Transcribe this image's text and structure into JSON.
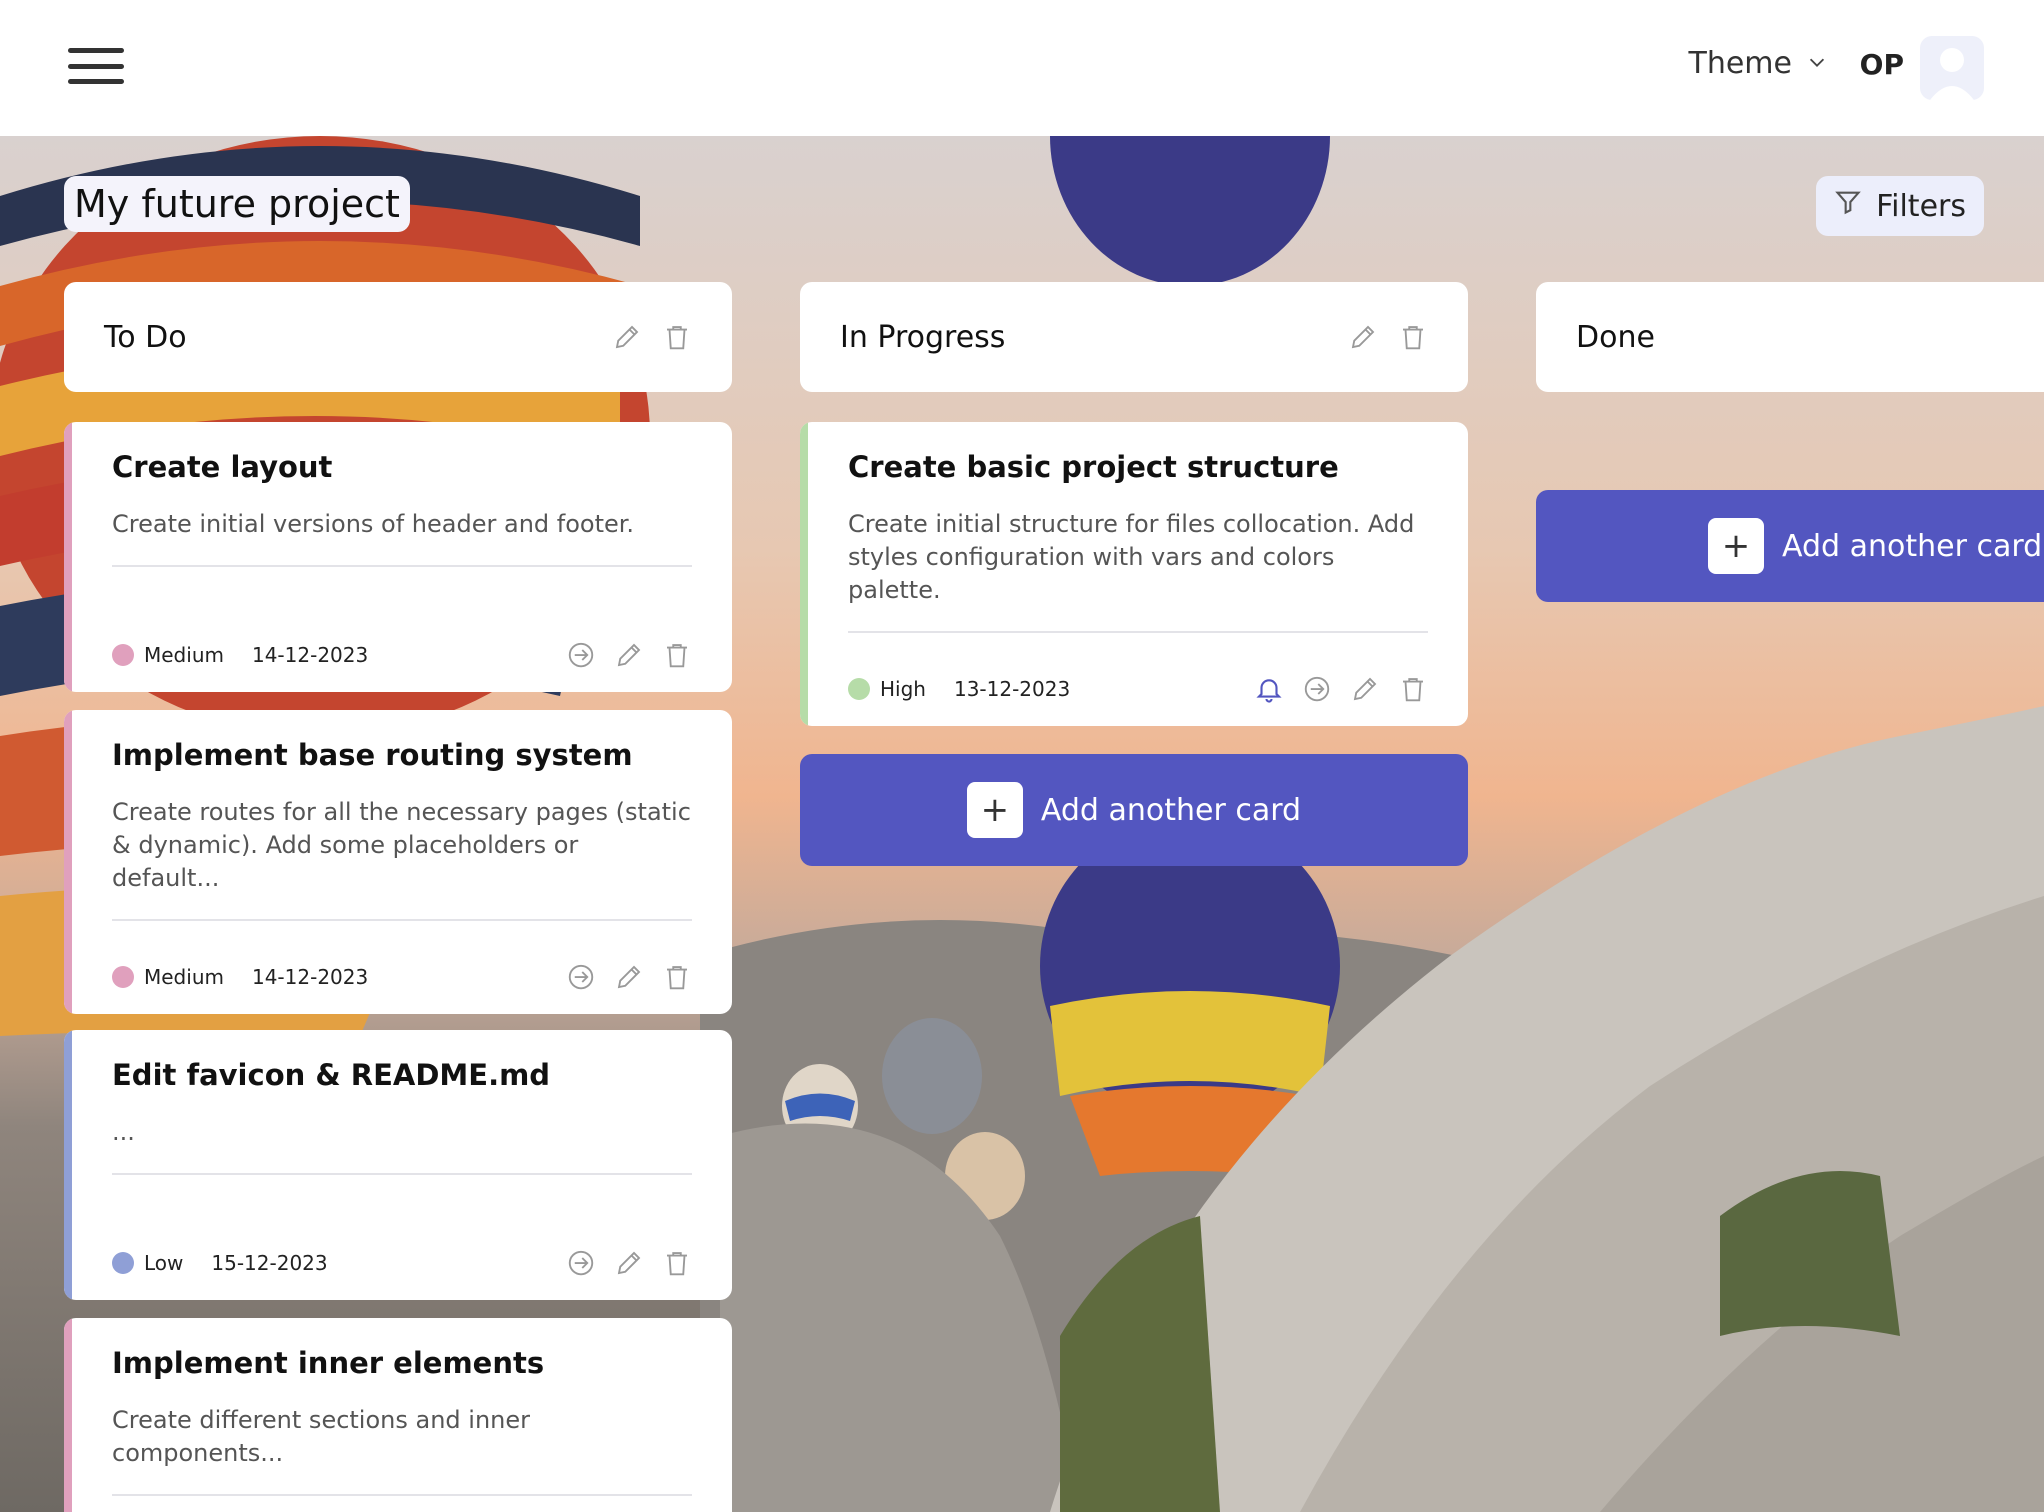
{
  "header": {
    "theme_label": "Theme",
    "user_initials": "OP",
    "menu_icon": "hamburger-icon",
    "avatar_icon": "user-avatar-icon"
  },
  "board": {
    "title": "My future project",
    "filters_label": "Filters",
    "add_card_label": "Add another card"
  },
  "columns": [
    {
      "title": "To Do",
      "cards": [
        {
          "title": "Create layout",
          "desc": "Create initial versions of header and footer.",
          "priority": "Medium",
          "date": "14-12-2023"
        },
        {
          "title": "Implement base routing system",
          "desc": "Create routes for all the necessary pages (static & dynamic). Add some placeholders or default...",
          "priority": "Medium",
          "date": "14-12-2023"
        },
        {
          "title": "Edit favicon & README.md",
          "desc": "...",
          "priority": "Low",
          "date": "15-12-2023"
        },
        {
          "title": "Implement inner elements",
          "desc": "Create different sections and inner components..."
        }
      ]
    },
    {
      "title": "In Progress",
      "cards": [
        {
          "title": "Create basic project structure",
          "desc": "Create initial structure for files collocation. Add styles configuration with vars and colors palette.",
          "priority": "High",
          "date": "13-12-2023"
        }
      ]
    },
    {
      "title": "Done",
      "cards": []
    }
  ],
  "colors": {
    "accent": "#5356c0",
    "priority_medium": "#e0a0bd",
    "priority_high": "#b6dca8",
    "priority_low": "#8f9fd6",
    "bell_active": "#5356c0"
  }
}
